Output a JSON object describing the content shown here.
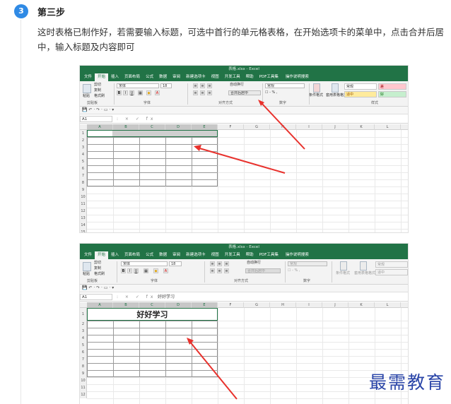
{
  "step": {
    "number": "3",
    "title": "第三步",
    "description": "这时表格已制作好，若需要输入标题，可选中首行的单元格表格，在开始选项卡的菜单中，点击合并后居中，输入标题及内容即可"
  },
  "colors": {
    "accent": "#2f8ae5",
    "excel_green": "#217346",
    "arrow_red": "#e8312c",
    "watermark": "#2a45a8"
  },
  "screenshot1": {
    "window_title": "表格.xlsx  -  Excel",
    "tabs": [
      "文件",
      "开始",
      "插入",
      "页面布局",
      "公式",
      "数据",
      "审阅",
      "新建选项卡",
      "视图",
      "开发工具",
      "帮助",
      "PDF工具集"
    ],
    "tell_me": "操作说明搜索",
    "clipboard": {
      "cut": "剪切",
      "copy": "复制",
      "painter": "格式刷",
      "paste": "粘贴",
      "label": "剪贴板"
    },
    "font": {
      "name": "宋体",
      "size": "18",
      "label": "字体"
    },
    "align": {
      "wrap": "自动换行",
      "merge": "合并后居中",
      "label": "对齐方式"
    },
    "number": {
      "format": "常规",
      "label": "数字"
    },
    "styles": {
      "cond": "条件格式",
      "table": "套用表格格式",
      "normal": "常规",
      "bad": "差",
      "neutral": "适中",
      "good": "好",
      "label": "样式"
    },
    "name_box": "A1",
    "formula": "",
    "columns": [
      "A",
      "B",
      "C",
      "D",
      "E",
      "F",
      "G",
      "H",
      "I",
      "J",
      "K",
      "L",
      "M",
      "N"
    ],
    "rows": [
      "1",
      "2",
      "3",
      "4",
      "5",
      "6",
      "7",
      "8",
      "9",
      "10",
      "11",
      "12",
      "13",
      "14",
      "15"
    ]
  },
  "screenshot2": {
    "window_title": "表格.xlsx  -  Excel",
    "tabs": [
      "文件",
      "开始",
      "插入",
      "页面布局",
      "公式",
      "数据",
      "审阅",
      "新建选项卡",
      "视图",
      "开发工具",
      "帮助",
      "PDF工具集"
    ],
    "tell_me": "操作说明搜索",
    "clipboard": {
      "cut": "剪切",
      "copy": "复制",
      "painter": "格式刷",
      "paste": "粘贴",
      "label": "剪贴板"
    },
    "font": {
      "name": "宋体",
      "size": "18",
      "label": "字体"
    },
    "align": {
      "wrap": "自动换行",
      "merge": "合并后居中",
      "label": "对齐方式"
    },
    "number": {
      "format": "常规",
      "label": "数字"
    },
    "styles": {
      "cond": "条件格式",
      "table": "套用表格格式",
      "normal": "常规",
      "neutral": "适中"
    },
    "name_box": "A1",
    "formula": "好好学习",
    "merged_title": "好好学习",
    "columns": [
      "A",
      "B",
      "C",
      "D",
      "E",
      "F",
      "G",
      "H",
      "I",
      "J",
      "K",
      "L",
      "M",
      "N"
    ],
    "rows": [
      "1",
      "2",
      "3",
      "4",
      "5",
      "6",
      "7",
      "8",
      "9",
      "10",
      "11",
      "12"
    ]
  },
  "watermark": "最需教育"
}
